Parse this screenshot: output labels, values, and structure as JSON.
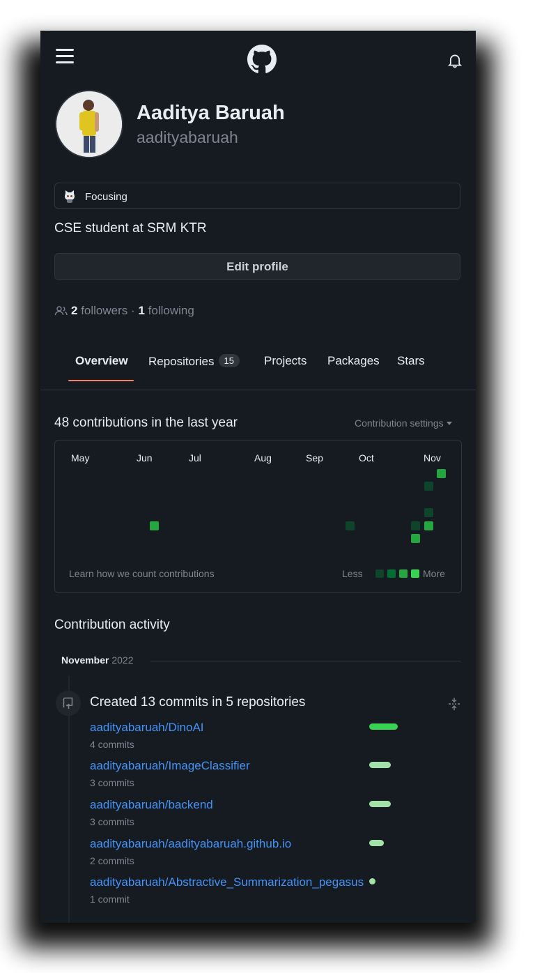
{
  "header": {
    "menu_icon": "hamburger-menu-icon",
    "logo_icon": "github-octocat-icon",
    "notification_icon": "bell-icon"
  },
  "profile": {
    "name": "Aaditya Baruah",
    "login": "aadityabaruah",
    "status": "Focusing",
    "status_icon": "octocat-emoji-icon",
    "bio": "CSE student at SRM KTR",
    "edit_label": "Edit profile",
    "followers_count": "2",
    "followers_label": "followers",
    "separator": "·",
    "following_count": "1",
    "following_label": "following"
  },
  "tabs": {
    "overview": "Overview",
    "repositories": "Repositories",
    "repositories_count": "15",
    "projects": "Projects",
    "packages": "Packages",
    "stars": "Stars"
  },
  "contributions": {
    "title": "48 contributions in the last year",
    "settings_label": "Contribution settings",
    "months": [
      "May",
      "Jun",
      "Jul",
      "Aug",
      "Sep",
      "Oct",
      "Nov"
    ],
    "help_link": "Learn how we count contributions",
    "legend_less": "Less",
    "legend_more": "More",
    "colors": {
      "level1": "#0e4429",
      "level2": "#006d32",
      "level3": "#26a641",
      "level4": "#39d353",
      "accent_underline": "#f78166",
      "link": "#4493f8"
    }
  },
  "activity": {
    "title": "Contribution activity",
    "month": "November",
    "year": "2022",
    "summary": "Created 13 commits in 5 repositories",
    "repos": [
      {
        "name": "aadityabaruah/DinoAI",
        "commits": "4 commits",
        "share": 4
      },
      {
        "name": "aadityabaruah/ImageClassifier",
        "commits": "3 commits",
        "share": 3
      },
      {
        "name": "aadityabaruah/backend",
        "commits": "3 commits",
        "share": 3
      },
      {
        "name": "aadityabaruah/aadityabaruah.github.io",
        "commits": "2 commits",
        "share": 2
      },
      {
        "name": "aadityabaruah/Abstractive_Summarization_pegasus",
        "commits": "1 commit",
        "share": 1
      }
    ]
  }
}
